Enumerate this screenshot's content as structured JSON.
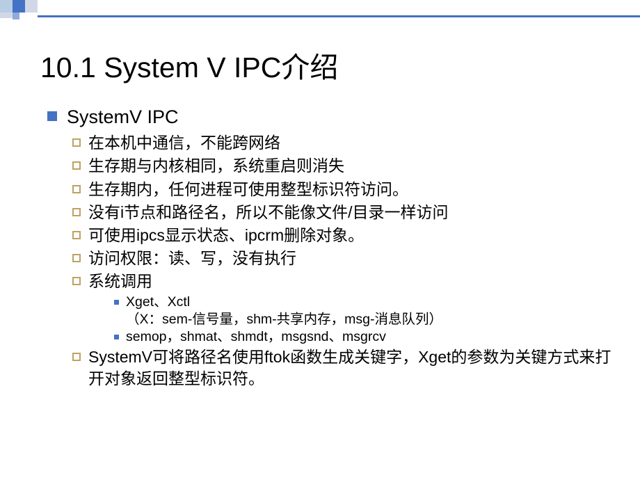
{
  "slide": {
    "title": "10.1 System V IPC介绍",
    "section_header": "SystemV IPC",
    "points": {
      "p1": "在本机中通信，不能跨网络",
      "p2": "生存期与内核相同，系统重启则消失",
      "p3": "生存期内，任何进程可使用整型标识符访问。",
      "p4": "没有i节点和路径名，所以不能像文件/目录一样访问",
      "p5": "可使用ipcs显示状态、ipcrm删除对象。",
      "p6": "访问权限：读、写，没有执行",
      "p7": "系统调用",
      "p8": "SystemV可将路径名使用ftok函数生成关键字，Xget的参数为关键方式来打开对象返回整型标识符。"
    },
    "subpoints": {
      "s1": "Xget、Xctl",
      "s1b": "（X：sem-信号量，shm-共享内存，msg-消息队列）",
      "s2": "semop，shmat、shmdt，msgsnd、msgrcv"
    }
  }
}
